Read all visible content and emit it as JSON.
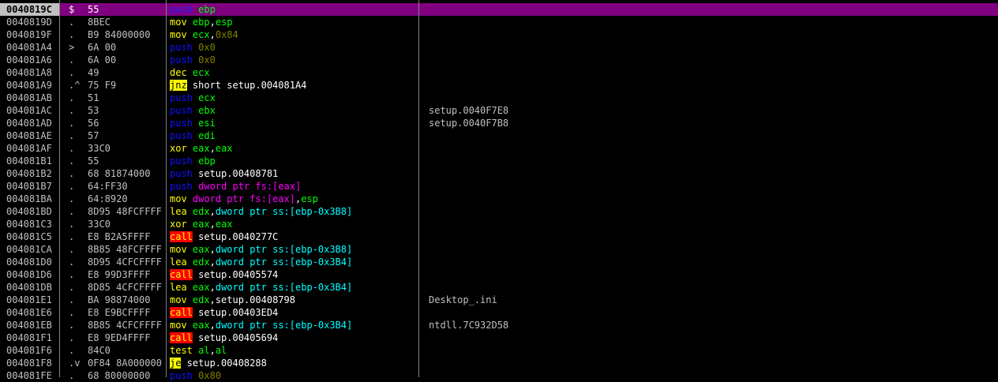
{
  "colors": {
    "background": "#000000",
    "selected_row": "#800080",
    "address": "#c0c0c0",
    "mnemonic": "#ffff00",
    "push_pop": "#1010ff",
    "register": "#00ff00",
    "constant": "#808000",
    "memory_ss": "#00ffff",
    "memory_fs": "#ff00ff",
    "jump_highlight": "#ffff00",
    "call_highlight": "#ff0000"
  },
  "rows": [
    {
      "addr": "0040819C",
      "mark": "$",
      "hex": "55",
      "asm": [
        {
          "t": "push",
          "c": "push"
        },
        {
          "t": " "
        },
        {
          "t": "ebp",
          "c": "reg"
        }
      ],
      "comment": "",
      "selected": true
    },
    {
      "addr": "0040819D",
      "mark": ".",
      "hex": "8BEC",
      "asm": [
        {
          "t": "mov",
          "c": "mn"
        },
        {
          "t": " "
        },
        {
          "t": "ebp",
          "c": "reg"
        },
        {
          "t": ","
        },
        {
          "t": "esp",
          "c": "reg"
        }
      ],
      "comment": ""
    },
    {
      "addr": "0040819F",
      "mark": ".",
      "hex": "B9 84000000",
      "asm": [
        {
          "t": "mov",
          "c": "mn"
        },
        {
          "t": " "
        },
        {
          "t": "ecx",
          "c": "reg"
        },
        {
          "t": ","
        },
        {
          "t": "0x84",
          "c": "num"
        }
      ],
      "comment": ""
    },
    {
      "addr": "004081A4",
      "mark": ">",
      "hex": "6A 00",
      "asm": [
        {
          "t": "push",
          "c": "push"
        },
        {
          "t": " "
        },
        {
          "t": "0x0",
          "c": "num"
        }
      ],
      "comment": ""
    },
    {
      "addr": "004081A6",
      "mark": ".",
      "hex": "6A 00",
      "asm": [
        {
          "t": "push",
          "c": "push"
        },
        {
          "t": " "
        },
        {
          "t": "0x0",
          "c": "num"
        }
      ],
      "comment": ""
    },
    {
      "addr": "004081A8",
      "mark": ".",
      "hex": "49",
      "asm": [
        {
          "t": "dec",
          "c": "mn"
        },
        {
          "t": " "
        },
        {
          "t": "ecx",
          "c": "reg"
        }
      ],
      "comment": ""
    },
    {
      "addr": "004081A9",
      "mark": ".^",
      "hex": "75 F9",
      "asm": [
        {
          "t": "jnz",
          "c": "jmp"
        },
        {
          "t": " short setup.004081A4",
          "c": "txt"
        }
      ],
      "comment": ""
    },
    {
      "addr": "004081AB",
      "mark": ".",
      "hex": "51",
      "asm": [
        {
          "t": "push",
          "c": "push"
        },
        {
          "t": " "
        },
        {
          "t": "ecx",
          "c": "reg"
        }
      ],
      "comment": ""
    },
    {
      "addr": "004081AC",
      "mark": ".",
      "hex": "53",
      "asm": [
        {
          "t": "push",
          "c": "push"
        },
        {
          "t": " "
        },
        {
          "t": "ebx",
          "c": "reg"
        }
      ],
      "comment": "setup.0040F7E8"
    },
    {
      "addr": "004081AD",
      "mark": ".",
      "hex": "56",
      "asm": [
        {
          "t": "push",
          "c": "push"
        },
        {
          "t": " "
        },
        {
          "t": "esi",
          "c": "reg"
        }
      ],
      "comment": "setup.0040F7B8"
    },
    {
      "addr": "004081AE",
      "mark": ".",
      "hex": "57",
      "asm": [
        {
          "t": "push",
          "c": "push"
        },
        {
          "t": " "
        },
        {
          "t": "edi",
          "c": "reg"
        }
      ],
      "comment": ""
    },
    {
      "addr": "004081AF",
      "mark": ".",
      "hex": "33C0",
      "asm": [
        {
          "t": "xor",
          "c": "mn"
        },
        {
          "t": " "
        },
        {
          "t": "eax",
          "c": "reg"
        },
        {
          "t": ","
        },
        {
          "t": "eax",
          "c": "reg"
        }
      ],
      "comment": ""
    },
    {
      "addr": "004081B1",
      "mark": ".",
      "hex": "55",
      "asm": [
        {
          "t": "push",
          "c": "push"
        },
        {
          "t": " "
        },
        {
          "t": "ebp",
          "c": "reg"
        }
      ],
      "comment": ""
    },
    {
      "addr": "004081B2",
      "mark": ".",
      "hex": "68 81874000",
      "asm": [
        {
          "t": "push",
          "c": "push"
        },
        {
          "t": " setup.00408781",
          "c": "txt"
        }
      ],
      "comment": ""
    },
    {
      "addr": "004081B7",
      "mark": ".",
      "hex": "64:FF30",
      "asm": [
        {
          "t": "push",
          "c": "push"
        },
        {
          "t": " "
        },
        {
          "t": "dword ptr fs:[eax]",
          "c": "fs"
        }
      ],
      "comment": ""
    },
    {
      "addr": "004081BA",
      "mark": ".",
      "hex": "64:8920",
      "asm": [
        {
          "t": "mov",
          "c": "mn"
        },
        {
          "t": " "
        },
        {
          "t": "dword ptr fs:[eax]",
          "c": "fs"
        },
        {
          "t": ","
        },
        {
          "t": "esp",
          "c": "reg"
        }
      ],
      "comment": ""
    },
    {
      "addr": "004081BD",
      "mark": ".",
      "hex": "8D95 48FCFFFF",
      "asm": [
        {
          "t": "lea",
          "c": "mn"
        },
        {
          "t": " "
        },
        {
          "t": "edx",
          "c": "reg"
        },
        {
          "t": ","
        },
        {
          "t": "dword ptr ss:[ebp-0x3B8]",
          "c": "ss"
        }
      ],
      "comment": ""
    },
    {
      "addr": "004081C3",
      "mark": ".",
      "hex": "33C0",
      "asm": [
        {
          "t": "xor",
          "c": "mn"
        },
        {
          "t": " "
        },
        {
          "t": "eax",
          "c": "reg"
        },
        {
          "t": ","
        },
        {
          "t": "eax",
          "c": "reg"
        }
      ],
      "comment": ""
    },
    {
      "addr": "004081C5",
      "mark": ".",
      "hex": "E8 B2A5FFFF",
      "asm": [
        {
          "t": "call",
          "c": "call"
        },
        {
          "t": " setup.0040277C",
          "c": "txt"
        }
      ],
      "comment": ""
    },
    {
      "addr": "004081CA",
      "mark": ".",
      "hex": "8B85 48FCFFFF",
      "asm": [
        {
          "t": "mov",
          "c": "mn"
        },
        {
          "t": " "
        },
        {
          "t": "eax",
          "c": "reg"
        },
        {
          "t": ","
        },
        {
          "t": "dword ptr ss:[ebp-0x3B8]",
          "c": "ss"
        }
      ],
      "comment": ""
    },
    {
      "addr": "004081D0",
      "mark": ".",
      "hex": "8D95 4CFCFFFF",
      "asm": [
        {
          "t": "lea",
          "c": "mn"
        },
        {
          "t": " "
        },
        {
          "t": "edx",
          "c": "reg"
        },
        {
          "t": ","
        },
        {
          "t": "dword ptr ss:[ebp-0x3B4]",
          "c": "ss"
        }
      ],
      "comment": ""
    },
    {
      "addr": "004081D6",
      "mark": ".",
      "hex": "E8 99D3FFFF",
      "asm": [
        {
          "t": "call",
          "c": "call"
        },
        {
          "t": " setup.00405574",
          "c": "txt"
        }
      ],
      "comment": ""
    },
    {
      "addr": "004081DB",
      "mark": ".",
      "hex": "8D85 4CFCFFFF",
      "asm": [
        {
          "t": "lea",
          "c": "mn"
        },
        {
          "t": " "
        },
        {
          "t": "eax",
          "c": "reg"
        },
        {
          "t": ","
        },
        {
          "t": "dword ptr ss:[ebp-0x3B4]",
          "c": "ss"
        }
      ],
      "comment": ""
    },
    {
      "addr": "004081E1",
      "mark": ".",
      "hex": "BA 98874000",
      "asm": [
        {
          "t": "mov",
          "c": "mn"
        },
        {
          "t": " "
        },
        {
          "t": "edx",
          "c": "reg"
        },
        {
          "t": ",setup.00408798",
          "c": "txt"
        }
      ],
      "comment": "Desktop_.ini"
    },
    {
      "addr": "004081E6",
      "mark": ".",
      "hex": "E8 E9BCFFFF",
      "asm": [
        {
          "t": "call",
          "c": "call"
        },
        {
          "t": " setup.00403ED4",
          "c": "txt"
        }
      ],
      "comment": ""
    },
    {
      "addr": "004081EB",
      "mark": ".",
      "hex": "8B85 4CFCFFFF",
      "asm": [
        {
          "t": "mov",
          "c": "mn"
        },
        {
          "t": " "
        },
        {
          "t": "eax",
          "c": "reg"
        },
        {
          "t": ","
        },
        {
          "t": "dword ptr ss:[ebp-0x3B4]",
          "c": "ss"
        }
      ],
      "comment": "ntdll.7C932D58"
    },
    {
      "addr": "004081F1",
      "mark": ".",
      "hex": "E8 9ED4FFFF",
      "asm": [
        {
          "t": "call",
          "c": "call"
        },
        {
          "t": " setup.00405694",
          "c": "txt"
        }
      ],
      "comment": ""
    },
    {
      "addr": "004081F6",
      "mark": ".",
      "hex": "84C0",
      "asm": [
        {
          "t": "test",
          "c": "mn"
        },
        {
          "t": " "
        },
        {
          "t": "al",
          "c": "reg"
        },
        {
          "t": ","
        },
        {
          "t": "al",
          "c": "reg"
        }
      ],
      "comment": ""
    },
    {
      "addr": "004081F8",
      "mark": ".v",
      "hex": "0F84 8A000000",
      "asm": [
        {
          "t": "je",
          "c": "jmp"
        },
        {
          "t": " setup.00408288",
          "c": "txt"
        }
      ],
      "comment": ""
    },
    {
      "addr": "004081FE",
      "mark": ".",
      "hex": "68 80000000",
      "asm": [
        {
          "t": "push",
          "c": "push"
        },
        {
          "t": " "
        },
        {
          "t": "0x80",
          "c": "num"
        }
      ],
      "comment": ""
    }
  ]
}
